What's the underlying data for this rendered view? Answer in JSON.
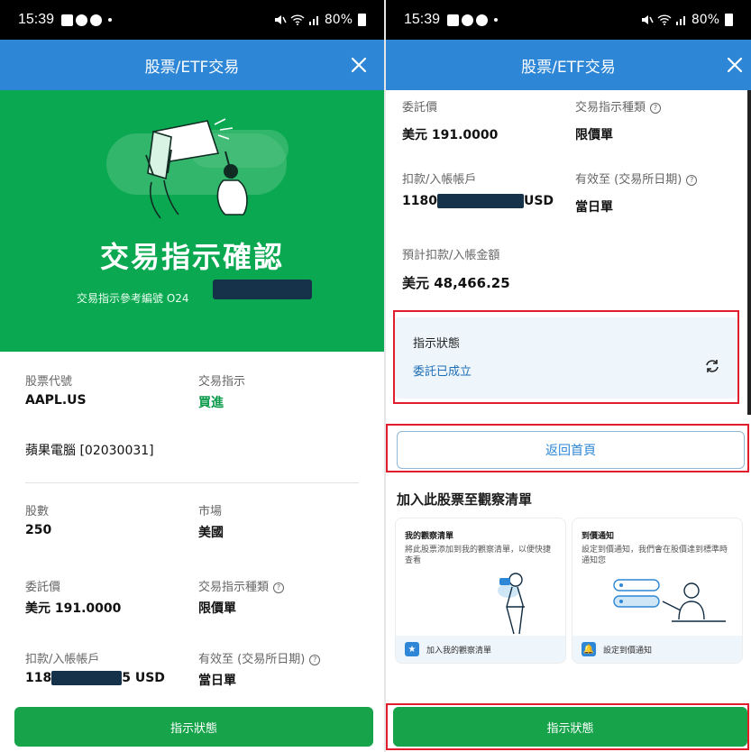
{
  "status_bar": {
    "time": "15:39",
    "dot": "•",
    "battery": "80%"
  },
  "app_bar": {
    "title": "股票/ETF交易",
    "close": "✕"
  },
  "left": {
    "hero_title": "交易指示確認",
    "ref_label": "交易指示參考編號 O24",
    "stock_code_label": "股票代號",
    "stock_code": "AAPL.US",
    "instruction_label": "交易指示",
    "instruction": "買進",
    "stock_name": "蘋果電腦 [02030031]",
    "shares_label": "股數",
    "shares": "250",
    "market_label": "市場",
    "market": "美國",
    "price_label": "委託價",
    "price": "美元 191.0000",
    "order_type_label": "交易指示種類",
    "order_type": "限價單",
    "account_label": "扣款/入帳帳戶",
    "account_prefix": "118",
    "account_suffix": "5 USD",
    "valid_label": "有效至 (交易所日期)",
    "valid": "當日單",
    "bottom_button": "指示狀態"
  },
  "right": {
    "price_label": "委託價",
    "price": "美元 191.0000",
    "order_type_label": "交易指示種類",
    "order_type": "限價單",
    "account_label": "扣款/入帳帳戶",
    "account_prefix": "1180",
    "account_suffix": "USD",
    "valid_label": "有效至 (交易所日期)",
    "valid": "當日單",
    "amount_label": "預計扣款/入帳金額",
    "amount": "美元 48,466.25",
    "status_label": "指示狀態",
    "status_value": "委託已成立",
    "home_button": "返回首頁",
    "watch_section_title": "加入此股票至觀察清單",
    "watch_card": {
      "title": "我的觀察清單",
      "desc": "將此股票添加到我的觀察清單，以便快捷查看",
      "action": "加入我的觀察清單",
      "icon": "★"
    },
    "alert_card": {
      "title": "到價通知",
      "desc": "設定到價通知，我們會在股價達到標準時通知您",
      "action": "設定到價通知",
      "icon": "🔔"
    },
    "bottom_button": "指示狀態"
  },
  "colors": {
    "app_bar": "#2d86d6",
    "hero": "#0aa851",
    "buy_green": "#0a9a4a",
    "button_green": "#16a34a",
    "highlight_red": "#e11d2b"
  },
  "icons": [
    "close-icon",
    "refresh-icon",
    "star-icon",
    "bell-icon",
    "help-icon",
    "wifi-icon",
    "signal-icon",
    "battery-icon"
  ]
}
